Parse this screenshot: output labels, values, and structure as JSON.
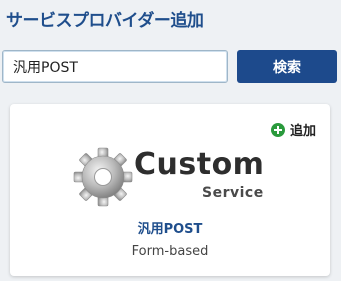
{
  "header": {
    "title": "サービスプロバイダー追加"
  },
  "search": {
    "value": "汎用POST",
    "button_label": "検索"
  },
  "card": {
    "add_label": "追加",
    "logo": {
      "icon": "gear-icon",
      "word": "Custom",
      "sub": "Service"
    },
    "provider_name": "汎用POST",
    "provider_type": "Form-based"
  },
  "colors": {
    "accent": "#1d4a8c",
    "title": "#1f4e8c",
    "add_icon": "#2a9a3c",
    "background": "#eef1f4"
  }
}
